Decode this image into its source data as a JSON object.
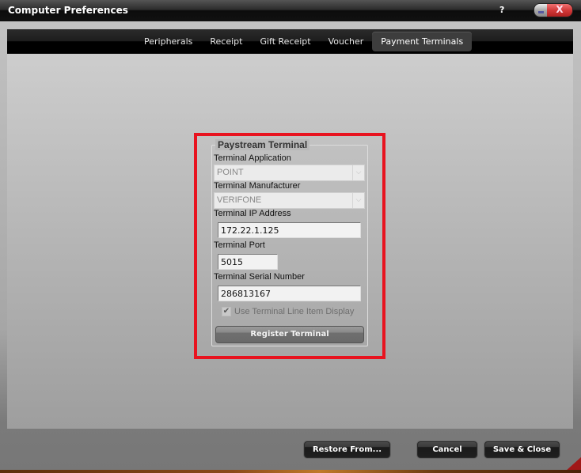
{
  "window": {
    "title": "Computer Preferences",
    "help_label": "?",
    "close_label": "X"
  },
  "tabs": [
    {
      "label": "Peripherals",
      "active": false
    },
    {
      "label": "Receipt",
      "active": false
    },
    {
      "label": "Gift Receipt",
      "active": false
    },
    {
      "label": "Voucher",
      "active": false
    },
    {
      "label": "Payment Terminals",
      "active": true
    }
  ],
  "terminal": {
    "group_title": "Paystream Terminal",
    "application_label": "Terminal Application",
    "application_value": "POINT",
    "manufacturer_label": "Terminal Manufacturer",
    "manufacturer_value": "VERIFONE",
    "ip_label": "Terminal IP Address",
    "ip_value": "172.22.1.125",
    "port_label": "Terminal Port",
    "port_value": "5015",
    "serial_label": "Terminal Serial Number",
    "serial_value": "286813167",
    "line_item_label": "Use Terminal Line Item Display",
    "line_item_checked": true,
    "check_glyph": "✔",
    "dropdown_glyph": "⌵",
    "register_label": "Register Terminal"
  },
  "footer": {
    "restore_label": "Restore From...",
    "cancel_label": "Cancel",
    "save_label": "Save & Close"
  },
  "colors": {
    "highlight_border": "#e8131f",
    "close_button": "#d23a3a"
  }
}
